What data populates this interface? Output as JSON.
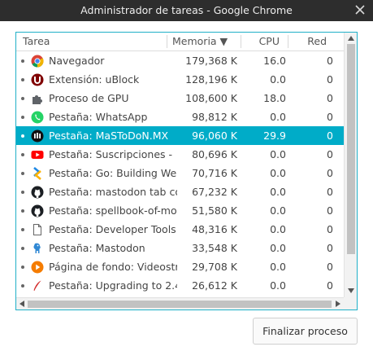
{
  "window": {
    "title": "Administrador de tareas - Google Chrome",
    "close_icon": "close-icon"
  },
  "table": {
    "columns": [
      {
        "label": "Tarea"
      },
      {
        "label": "Memoria ▼",
        "sorted": "descending"
      },
      {
        "label": "CPU"
      },
      {
        "label": "Red"
      }
    ],
    "rows": [
      {
        "icon": "chrome-icon",
        "task": "Navegador",
        "memory": "179,368 K",
        "cpu": "16.0",
        "network": "0"
      },
      {
        "icon": "ublock-icon",
        "task": "Extensión: uBlock",
        "memory": "128,196 K",
        "cpu": "0.0",
        "network": "0"
      },
      {
        "icon": "puzzle-icon",
        "task": "Proceso de GPU",
        "memory": "108,600 K",
        "cpu": "18.0",
        "network": "0"
      },
      {
        "icon": "whatsapp-icon",
        "task": "Pestaña: WhatsApp",
        "memory": "98,812 K",
        "cpu": "0.0",
        "network": "0"
      },
      {
        "icon": "mastodon-pawoo-icon",
        "task": "Pestaña: MaSToDoN.MX",
        "memory": "96,060 K",
        "cpu": "29.9",
        "network": "0",
        "selected": true
      },
      {
        "icon": "youtube-icon",
        "task": "Pestaña: Suscripciones -",
        "memory": "80,696 K",
        "cpu": "0.0",
        "network": "0"
      },
      {
        "icon": "go-icon",
        "task": "Pestaña: Go: Building We",
        "memory": "70,716 K",
        "cpu": "0.0",
        "network": "0"
      },
      {
        "icon": "github-icon",
        "task": "Pestaña: mastodon tab co",
        "memory": "67,232 K",
        "cpu": "0.0",
        "network": "0"
      },
      {
        "icon": "github-icon",
        "task": "Pestaña: spellbook-of-mo",
        "memory": "51,580 K",
        "cpu": "0.0",
        "network": "0"
      },
      {
        "icon": "document-icon",
        "task": "Pestaña: Developer Tools",
        "memory": "48,316 K",
        "cpu": "0.0",
        "network": "0"
      },
      {
        "icon": "mastodon-mascot-icon",
        "task": "Pestaña: Mastodon",
        "memory": "33,548 K",
        "cpu": "0.0",
        "network": "0"
      },
      {
        "icon": "play-icon",
        "task": "Página de fondo: Videostr",
        "memory": "29,708 K",
        "cpu": "0.0",
        "network": "0"
      },
      {
        "icon": "feather-icon",
        "task": "Pestaña: Upgrading to 2.4",
        "memory": "26,612 K",
        "cpu": "0.0",
        "network": "0"
      }
    ]
  },
  "actions": {
    "end_process_label": "Finalizar proceso"
  },
  "colors": {
    "titlebar": "#2d2d2d",
    "accent": "#00acc8",
    "panel_border": "#21b0c8"
  }
}
